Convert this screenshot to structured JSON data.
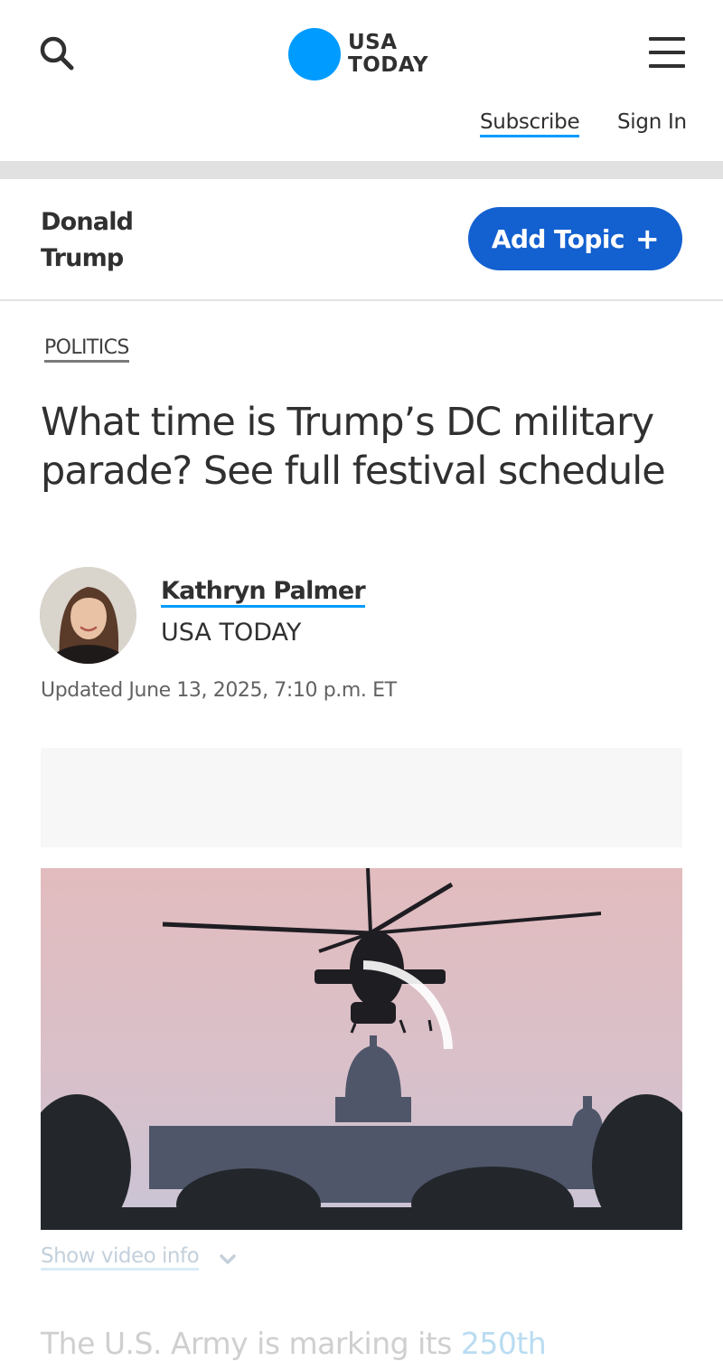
{
  "header": {
    "logo_line1": "USA",
    "logo_line2": "TODAY",
    "subscribe_label": "Subscribe",
    "signin_label": "Sign In",
    "icons": {
      "search": "search-icon",
      "menu": "hamburger-menu-icon"
    }
  },
  "topic": {
    "name": "Donald Trump",
    "add_label": "Add Topic",
    "add_symbol": "+"
  },
  "article": {
    "category": "POLITICS",
    "headline": "What time is Trump’s DC military parade? See full festival schedule",
    "author": "Kathryn Palmer",
    "organization": "USA TODAY",
    "updated": "Updated June 13, 2025, 7:10 p.m. ET",
    "show_video_info": "Show video info",
    "body_start": "The U.S. Army is marking its ",
    "body_link": "250th"
  },
  "colors": {
    "brand_blue": "#009bff",
    "button_blue": "#1360d0",
    "text": "#303030"
  }
}
